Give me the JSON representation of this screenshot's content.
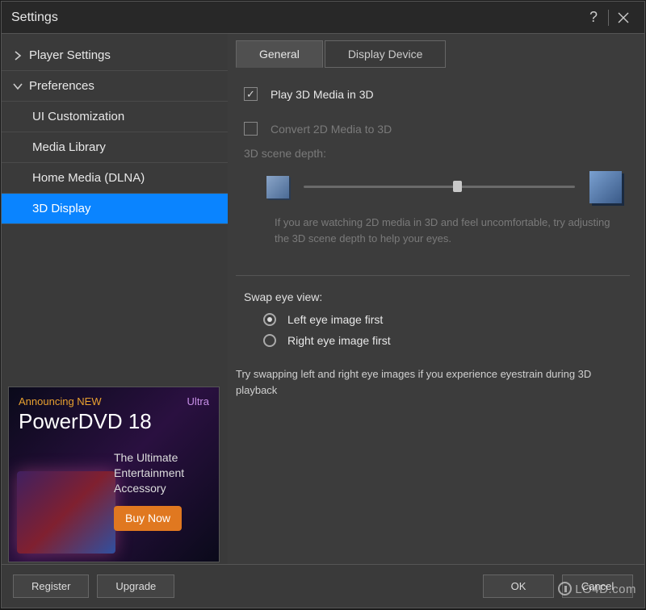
{
  "window": {
    "title": "Settings"
  },
  "sidebar": {
    "sections": [
      {
        "label": "Player Settings",
        "expanded": false
      },
      {
        "label": "Preferences",
        "expanded": true
      }
    ],
    "items": [
      {
        "label": "UI Customization",
        "selected": false
      },
      {
        "label": "Media Library",
        "selected": false
      },
      {
        "label": "Home Media (DLNA)",
        "selected": false
      },
      {
        "label": "3D Display",
        "selected": true
      }
    ]
  },
  "ad": {
    "preheader": "Announcing NEW",
    "edition": "Ultra",
    "title": "PowerDVD 18",
    "tagline": "The Ultimate Entertainment Accessory",
    "cta": "Buy Now"
  },
  "tabs": [
    {
      "label": "General",
      "active": true
    },
    {
      "label": "Display Device",
      "active": false
    }
  ],
  "options": {
    "play3d": {
      "label": "Play 3D Media in 3D",
      "checked": true
    },
    "convert2d": {
      "label": "Convert 2D Media to 3D",
      "checked": false
    },
    "depth_label": "3D scene depth:",
    "depth_hint": "If you are watching 2D media in 3D and feel uncomfortable, try adjusting the 3D scene depth to help your eyes.",
    "swap_label": "Swap eye view:",
    "swap_left": "Left eye image first",
    "swap_right": "Right eye image first",
    "swap_hint": "Try swapping left and right eye images if you experience eyestrain during 3D playback"
  },
  "buttons": {
    "register": "Register",
    "upgrade": "Upgrade",
    "ok": "OK",
    "cancel": "Cancel"
  },
  "watermark": "LO4D.com"
}
